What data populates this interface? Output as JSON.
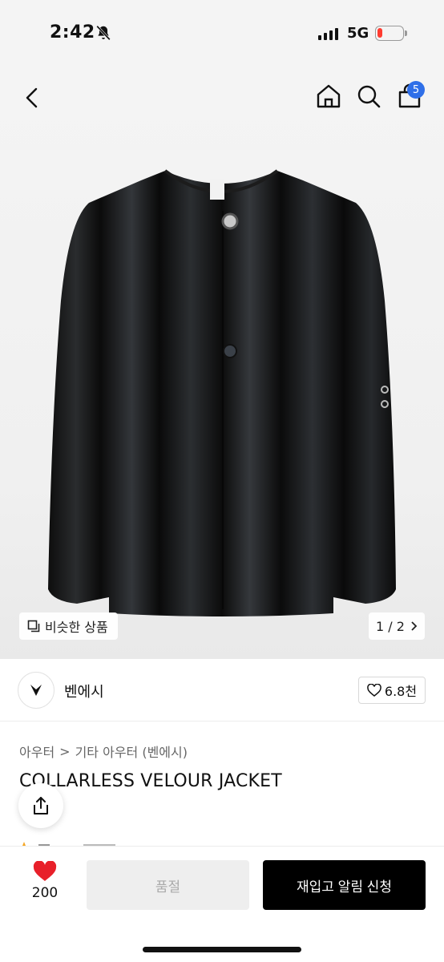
{
  "status_bar": {
    "time": "2:42",
    "network": "5G",
    "battery_fraction": 0.2,
    "battery_color": "#ff3b30"
  },
  "nav": {
    "cart_count": "5",
    "accent": "#2f6fe8",
    "icons": [
      "chevron-left-icon",
      "home-icon",
      "search-icon",
      "bag-icon"
    ]
  },
  "gallery": {
    "similar_label": "비슷한 상품",
    "page_indicator": "1 / 2"
  },
  "brand": {
    "name": "벤에시",
    "like_count": "6.8천"
  },
  "product": {
    "breadcrumb": [
      "아우터",
      "기타 아우터 (벤에시)"
    ],
    "title": "COLLARLESS VELOUR JACKET"
  },
  "bottom_bar": {
    "wish_count": "200",
    "soldout_label": "품절",
    "restock_label": "재입고 알림 신청",
    "wish_color": "#e8202a"
  }
}
